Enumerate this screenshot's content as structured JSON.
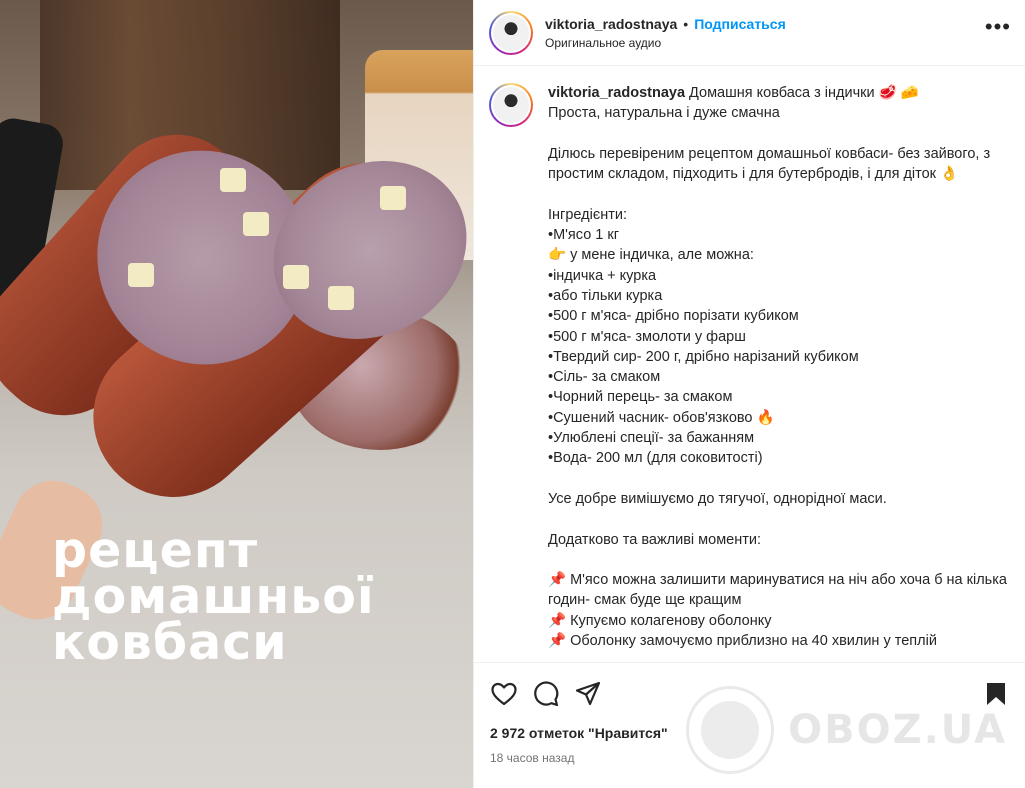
{
  "media": {
    "overlay_lines": [
      "рецепт",
      "домашньої",
      "ковбаси"
    ]
  },
  "header": {
    "username": "viktoria_radostnaya",
    "separator": "•",
    "follow_label": "Подписаться",
    "audio_label": "Оригинальное аудио",
    "more_icon": "more-horizontal-icon"
  },
  "caption": {
    "username": "viktoria_radostnaya",
    "text": " Домашня ковбаса з індички 🥩 🧀\nПроста, натуральна і дуже смачна\n\nДілюсь перевіреним рецептом домашньої ковбаси- без зайвого, з простим складом, підходить і для бутербродів, і для діток 👌\n\nІнгредієнти:\n•М'ясо 1 кг\n👉 у мене індичка, але можна:\n•індичка + курка\n•або тільки курка\n•500 г м'яса- дрібно порізати кубиком\n•500 г м'яса- змолоти у фарш\n•Твердий сир- 200 г, дрібно нарізаний кубиком\n•Сіль- за смаком\n•Чорний перець- за смаком\n•Сушений часник- обов'язково 🔥\n•Улюблені спеції- за бажанням\n•Вода- 200 мл (для соковитості)\n\nУсе добре вимішуємо до тягучої, однорідної маси.\n\nДодатково та важливі моменти:\n\n📌 М'ясо можна залишити маринуватися на ніч або хоча б на кілька годин- смак буде ще кращим\n📌 Купуємо колагенову оболонку\n📌 Оболонку замочуємо приблизно на 40 хвилин у теплій"
  },
  "actions": {
    "like_icon": "heart-icon",
    "comment_icon": "comment-icon",
    "share_icon": "share-icon",
    "save_icon": "bookmark-icon",
    "likes_text": "2 972 отметок \"Нравится\"",
    "time_text": "18 часов назад"
  },
  "watermark": {
    "text": "OBOZ.UA"
  }
}
